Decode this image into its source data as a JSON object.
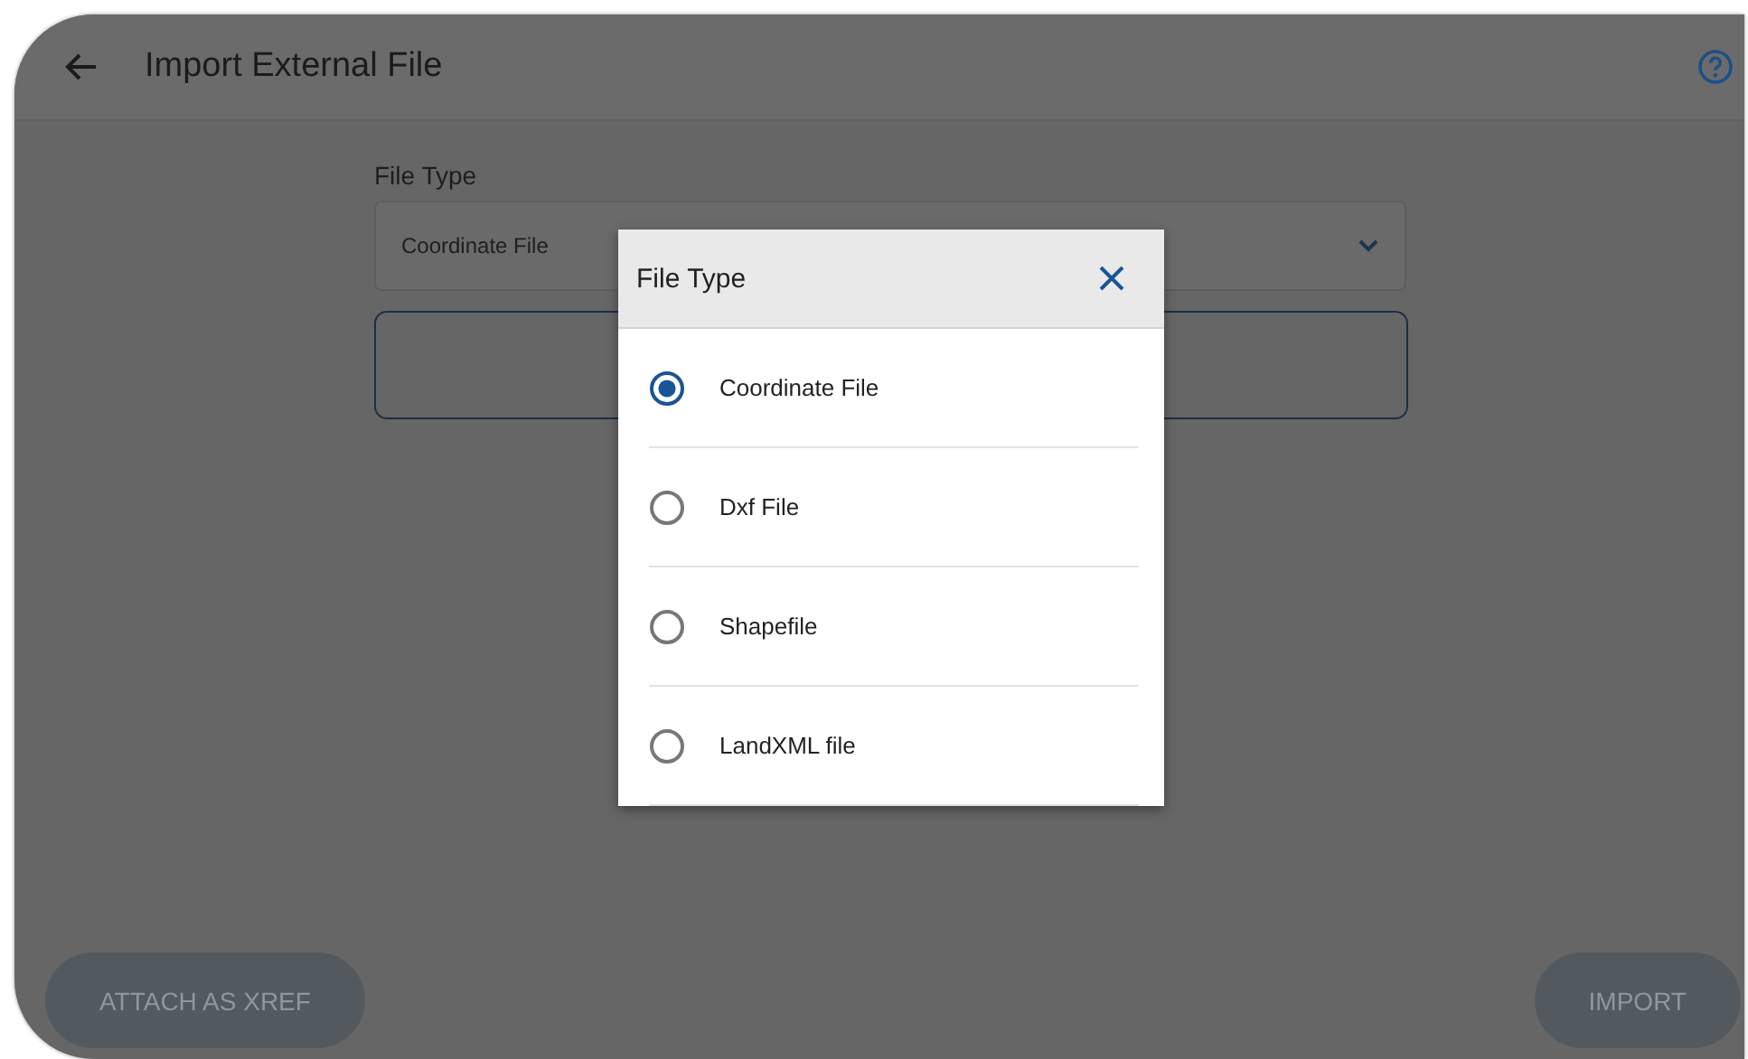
{
  "header": {
    "title": "Import External File"
  },
  "form": {
    "label": "File Type",
    "value": "Coordinate File"
  },
  "dialog": {
    "title": "File Type",
    "options": [
      {
        "label": "Coordinate File",
        "selected": true
      },
      {
        "label": "Dxf File",
        "selected": false
      },
      {
        "label": "Shapefile",
        "selected": false
      },
      {
        "label": "LandXML file",
        "selected": false
      }
    ]
  },
  "buttons": [
    {
      "label": "ATTACH AS XREF",
      "disabled": true
    },
    {
      "label": "IMPORT",
      "disabled": true
    }
  ]
}
